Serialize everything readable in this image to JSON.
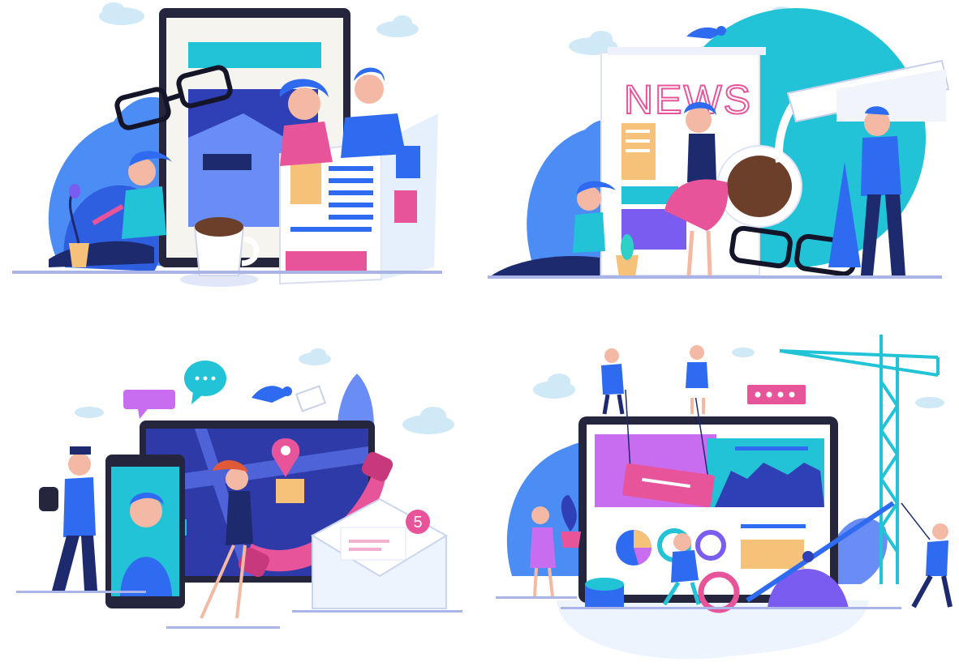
{
  "scenes": {
    "news": {
      "headline": "NEWS"
    },
    "messaging": {
      "notification_count": "5"
    }
  },
  "colors": {
    "blue": "#2f6bf0",
    "violet": "#7a5cf0",
    "cyan": "#22c3d6",
    "pink": "#e8549a",
    "navy": "#1d2a6e",
    "teal": "#2fd0c8",
    "yellow": "#f6c27a",
    "cloud": "#cfe9f7",
    "ground": "#aab4e6"
  },
  "icons": [
    "cloud-icon",
    "glasses-icon",
    "coffee-cup-icon",
    "speech-bubble-icon",
    "bird-icon",
    "map-pin-icon",
    "phone-handset-icon",
    "envelope-icon",
    "crane-icon",
    "pie-chart-icon"
  ]
}
